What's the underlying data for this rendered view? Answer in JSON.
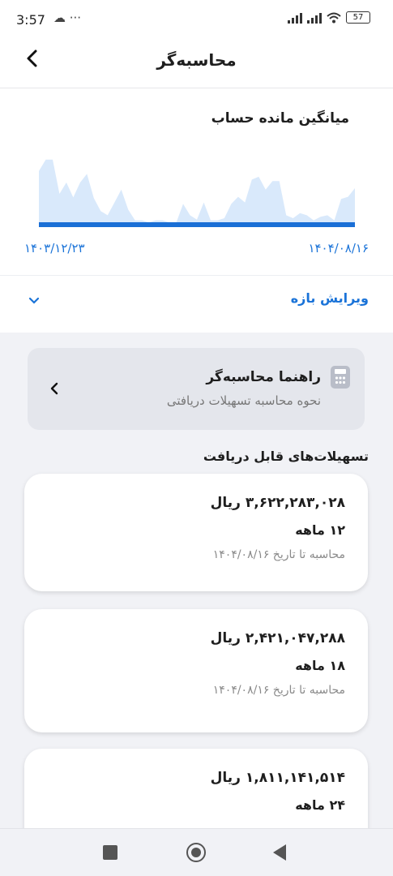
{
  "status_bar": {
    "time": "3:57",
    "left_icons": "☁ ···",
    "battery": "57"
  },
  "app_bar": {
    "title": "محاسبه‌گر"
  },
  "balance_chart": {
    "title": "میانگین مانده حساب",
    "date_start": "۱۴۰۳/۱۲/۲۳",
    "date_end": "۱۴۰۴/۰۸/۱۶",
    "fill_color": "#d9e9fb",
    "line_color": "#1a6fd6"
  },
  "chart_data": {
    "type": "area",
    "x_start": "۱۴۰۳/۱۲/۲۳",
    "x_end": "۱۴۰۴/۰۸/۱۶",
    "values": [
      0.74,
      0.9,
      0.9,
      0.42,
      0.58,
      0.37,
      0.58,
      0.7,
      0.36,
      0.18,
      0.12,
      0.3,
      0.48,
      0.2,
      0.05,
      0.05,
      0.02,
      0.05,
      0.05,
      0.02,
      0.02,
      0.28,
      0.12,
      0.06,
      0.3,
      0.05,
      0.05,
      0.08,
      0.28,
      0.38,
      0.3,
      0.62,
      0.66,
      0.48,
      0.6,
      0.6,
      0.12,
      0.08,
      0.15,
      0.12,
      0.05,
      0.1,
      0.12,
      0.05,
      0.35,
      0.38,
      0.5
    ]
  },
  "edit_range": {
    "label": "ویرایش بازه"
  },
  "guide": {
    "title": "راهنما محاسبه‌گر",
    "subtitle": "نحوه محاسبه تسهیلات دریافتی"
  },
  "facilities_title": "تسهیلات‌های قابل دریافت",
  "loans": [
    {
      "amount": "۳,۶۲۲,۲۸۳,۰۲۸ ریال",
      "term": "۱۲ ماهه",
      "calc_date": "محاسبه تا تاریخ ۱۴۰۴/۰۸/۱۶"
    },
    {
      "amount": "۲,۴۲۱,۰۴۷,۲۸۸ ریال",
      "term": "۱۸ ماهه",
      "calc_date": "محاسبه تا تاریخ ۱۴۰۴/۰۸/۱۶"
    },
    {
      "amount": "۱,۸۱۱,۱۴۱,۵۱۴ ریال",
      "term": "۲۴ ماهه",
      "calc_date": ""
    }
  ]
}
